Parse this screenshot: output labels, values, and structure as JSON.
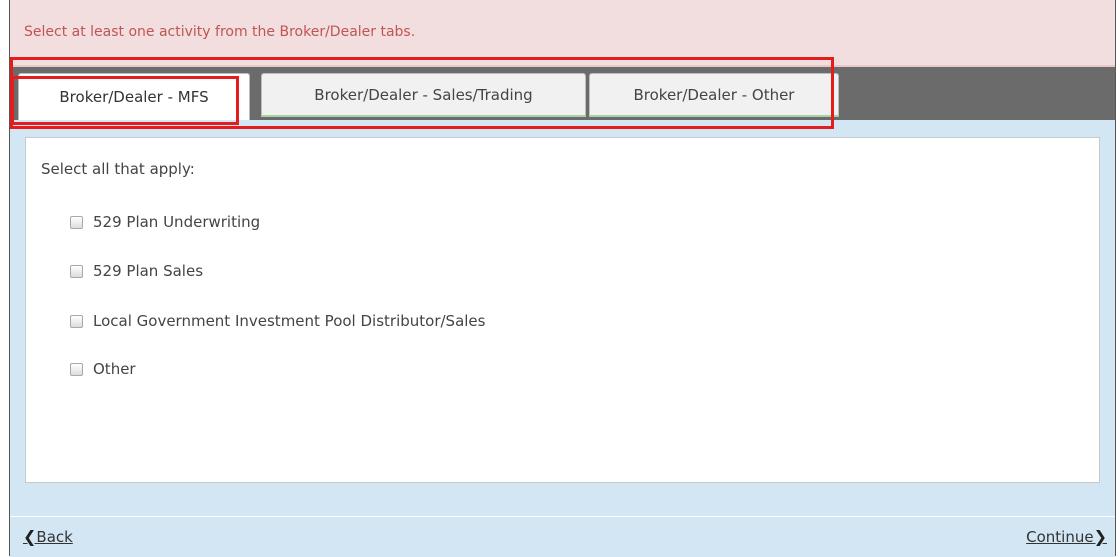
{
  "alert": {
    "message": "Select at least one activity from the Broker/Dealer tabs."
  },
  "tabs": [
    {
      "label": "Broker/Dealer - MFS",
      "active": true
    },
    {
      "label": "Broker/Dealer - Sales/Trading",
      "active": false
    },
    {
      "label": "Broker/Dealer - Other",
      "active": false
    }
  ],
  "panel": {
    "instruction": "Select all that apply:",
    "options": [
      {
        "label": "529 Plan Underwriting",
        "checked": false
      },
      {
        "label": "529 Plan Sales",
        "checked": false
      },
      {
        "label": "Local Government Investment Pool Distributor/Sales",
        "checked": false
      },
      {
        "label": "Other",
        "checked": false
      }
    ]
  },
  "footer": {
    "back_label": "Back",
    "continue_label": "Continue",
    "back_icon": "chevron-left-icon",
    "continue_icon": "chevron-right-icon"
  },
  "colors": {
    "alert_text": "#c15454",
    "alert_bg": "#f2dede",
    "callout": "#e51c1c",
    "tabbar_bg": "#6b6b6b",
    "page_bg": "#d3e6f4"
  }
}
